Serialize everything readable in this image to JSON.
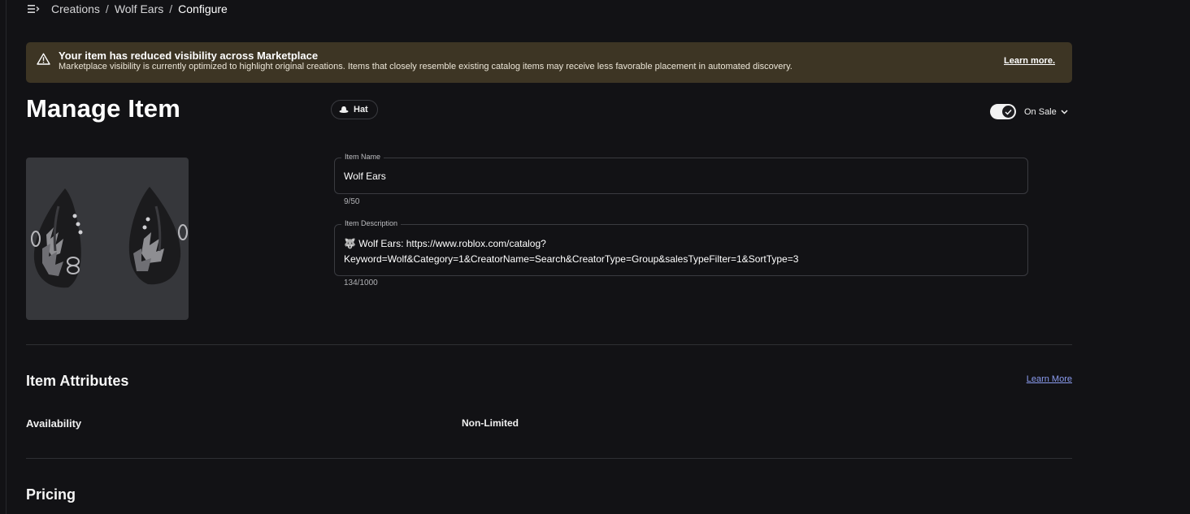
{
  "breadcrumb": {
    "items": [
      "Creations",
      "Wolf Ears"
    ],
    "current": "Configure",
    "separator": "/"
  },
  "banner": {
    "title": "Your item has reduced visibility across Marketplace",
    "body": "Marketplace visibility is currently optimized to highlight original creations. Items that closely resemble existing catalog items may receive less favorable placement in automated discovery.",
    "link": "Learn more.",
    "icon": "warning-icon",
    "background": "#3d3524"
  },
  "page": {
    "title": "Manage Item",
    "type_chip": "Hat",
    "type_icon": "hat-icon",
    "sale_status": "On Sale",
    "on_sale": true
  },
  "item": {
    "thumbnail": "wolf-ears-thumbnail",
    "name_label": "Item Name",
    "name": "Wolf Ears",
    "name_count": "9/50",
    "description_label": "Item Description",
    "description": "🐺 Wolf Ears: https://www.roblox.com/catalog?\nKeyword=Wolf&Category=1&CreatorName=Search&CreatorType=Group&salesTypeFilter=1&SortType=3",
    "description_count": "134/1000"
  },
  "attributes": {
    "title": "Item Attributes",
    "learn_more": "Learn More",
    "availability_label": "Availability",
    "availability_value": "Non-Limited"
  },
  "pricing": {
    "title": "Pricing"
  },
  "colors": {
    "background": "#121215",
    "link": "#8b9cf0"
  }
}
